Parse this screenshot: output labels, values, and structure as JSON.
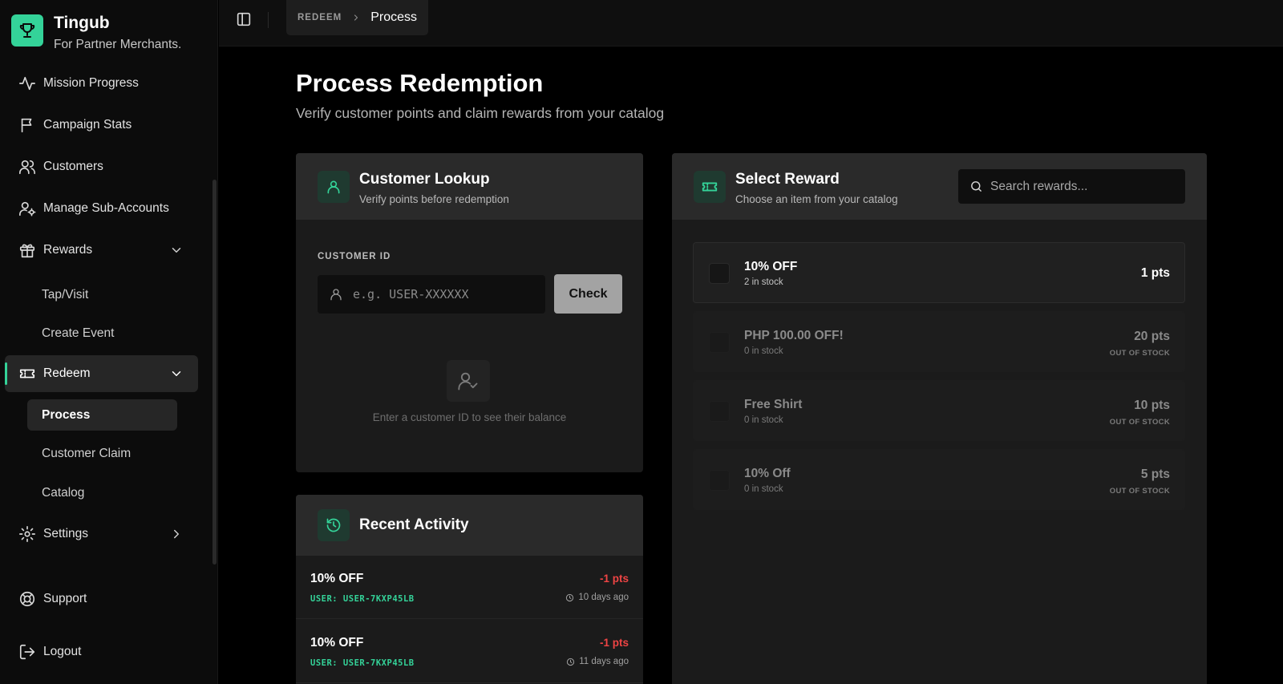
{
  "brand": {
    "name": "Tingub",
    "tagline": "For Partner Merchants."
  },
  "sidebar": {
    "items": [
      {
        "label": "Mission Progress",
        "icon": "activity-icon"
      },
      {
        "label": "Campaign Stats",
        "icon": "flag-icon"
      },
      {
        "label": "Customers",
        "icon": "users-icon"
      },
      {
        "label": "Manage Sub-Accounts",
        "icon": "user-cog-icon"
      },
      {
        "label": "Rewards",
        "icon": "gift-icon",
        "expanded": true,
        "children": [
          "Tap/Visit",
          "Create Event"
        ]
      },
      {
        "label": "Redeem",
        "icon": "ticket-icon",
        "expanded": true,
        "active": true,
        "children": [
          "Process",
          "Customer Claim",
          "Catalog"
        ],
        "active_child": "Process"
      },
      {
        "label": "Settings",
        "icon": "gear-icon",
        "expanded": false
      }
    ],
    "footer": [
      {
        "label": "Support",
        "icon": "lifebuoy-icon"
      },
      {
        "label": "Logout",
        "icon": "logout-icon"
      }
    ]
  },
  "breadcrumb": {
    "root": "REDEEM",
    "current": "Process"
  },
  "page": {
    "title": "Process Redemption",
    "subtitle": "Verify customer points and claim rewards from your catalog"
  },
  "lookup": {
    "title": "Customer Lookup",
    "subtitle": "Verify points before redemption",
    "field_label": "CUSTOMER ID",
    "placeholder": "e.g. USER-XXXXXX",
    "value": "",
    "check_label": "Check",
    "empty_text": "Enter a customer ID to see their balance"
  },
  "activity": {
    "title": "Recent Activity",
    "items": [
      {
        "name": "10% OFF",
        "user": "USER: USER-7KXP45LB",
        "points": "-1 pts",
        "time": "10 days ago"
      },
      {
        "name": "10% OFF",
        "user": "USER: USER-7KXP45LB",
        "points": "-1 pts",
        "time": "11 days ago"
      }
    ]
  },
  "rewards": {
    "title": "Select Reward",
    "subtitle": "Choose an item from your catalog",
    "search_placeholder": "Search rewards...",
    "items": [
      {
        "name": "10% OFF",
        "stock": "2 in stock",
        "points": "1 pts",
        "out_of_stock": false
      },
      {
        "name": "PHP 100.00 OFF!",
        "stock": "0 in stock",
        "points": "20 pts",
        "out_of_stock": true,
        "status": "OUT OF STOCK"
      },
      {
        "name": "Free Shirt",
        "stock": "0 in stock",
        "points": "10 pts",
        "out_of_stock": true,
        "status": "OUT OF STOCK"
      },
      {
        "name": "10% Off",
        "stock": "0 in stock",
        "points": "5 pts",
        "out_of_stock": true,
        "status": "OUT OF STOCK"
      }
    ]
  },
  "colors": {
    "accent": "#34d399",
    "negative": "#ef4444",
    "background": "#000000",
    "card": "#1b1b1b",
    "card_header": "#2a2a2a"
  }
}
